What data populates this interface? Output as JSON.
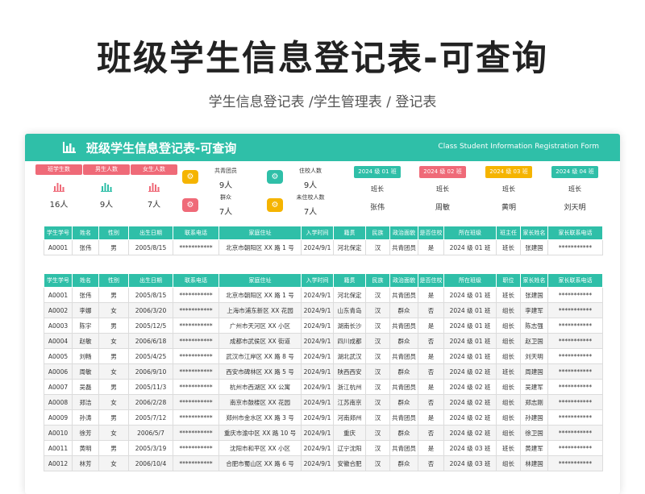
{
  "page": {
    "title": "班级学生信息登记表-可查询",
    "subtitle": "学生信息登记表 /学生管理表 / 登记表"
  },
  "banner": {
    "title": "班级学生信息登记表-可查询",
    "english": "Class Student Information Registration Form",
    "icon": "bar-chart-icon"
  },
  "stats": [
    {
      "label": "班学生数",
      "value": "16人"
    },
    {
      "label": "男生人数",
      "value": "9人"
    },
    {
      "label": "女生人数",
      "value": "7人"
    }
  ],
  "politics": [
    {
      "label": "共青团员",
      "value": "9人",
      "color": "#f5b400",
      "icon": "gear-icon"
    },
    {
      "label": "群众",
      "value": "7人",
      "color": "#ef6a78",
      "icon": "gear-icon"
    },
    {
      "label": "住校人数",
      "value": "9人",
      "color": "#2fbfa8",
      "icon": "gear-icon"
    },
    {
      "label": "未住校人数",
      "value": "7人",
      "color": "#f5b400",
      "icon": "gear-icon"
    }
  ],
  "groups": [
    {
      "label": "2024 级 01 班",
      "role": "班长",
      "name": "张伟",
      "color": "#2fbfa8"
    },
    {
      "label": "2024 级 02 班",
      "role": "班长",
      "name": "周敏",
      "color": "#ef6a78"
    },
    {
      "label": "2024 级 03 班",
      "role": "班长",
      "name": "黄明",
      "color": "#f5b400"
    },
    {
      "label": "2024 级 04 班",
      "role": "班长",
      "name": "刘天明",
      "color": "#2fbfa8"
    }
  ],
  "query": {
    "headers": [
      "学生学号",
      "姓名",
      "性别",
      "出生日期",
      "联系电话",
      "家庭住址",
      "入学时间",
      "籍贯",
      "民族",
      "政治面貌",
      "是否住校",
      "所在班级",
      "班主任",
      "家长姓名",
      "家长联系电话"
    ],
    "rows": [
      [
        "A0001",
        "张伟",
        "男",
        "2005/8/15",
        "***********",
        "北京市朝阳区 XX 路 1 号",
        "2024/9/1",
        "河北保定",
        "汉",
        "共青团员",
        "是",
        "2024 级 01 班",
        "班长",
        "张建国",
        "***********"
      ]
    ]
  },
  "main_table": {
    "headers": [
      "学生学号",
      "姓名",
      "性别",
      "出生日期",
      "联系电话",
      "家庭住址",
      "入学时间",
      "籍贯",
      "民族",
      "政治面貌",
      "是否住校",
      "所在班级",
      "职位",
      "家长姓名",
      "家长联系电话"
    ],
    "rows": [
      [
        "A0001",
        "张伟",
        "男",
        "2005/8/15",
        "***********",
        "北京市朝阳区 XX 路 1 号",
        "2024/9/1",
        "河北保定",
        "汉",
        "共青团员",
        "是",
        "2024 级 01 班",
        "班长",
        "张建国",
        "***********"
      ],
      [
        "A0002",
        "李娜",
        "女",
        "2006/3/20",
        "***********",
        "上海市浦东新区 XX 花园",
        "2024/9/1",
        "山东青岛",
        "汉",
        "群众",
        "否",
        "2024 级 01 班",
        "组长",
        "李建军",
        "***********"
      ],
      [
        "A0003",
        "陈宇",
        "男",
        "2005/12/5",
        "***********",
        "广州市天河区 XX 小区",
        "2024/9/1",
        "湖南长沙",
        "汉",
        "共青团员",
        "是",
        "2024 级 01 班",
        "组长",
        "陈志强",
        "***********"
      ],
      [
        "A0004",
        "赵敏",
        "女",
        "2006/6/18",
        "***********",
        "成都市武侯区 XX 街道",
        "2024/9/1",
        "四川成都",
        "汉",
        "群众",
        "否",
        "2024 级 01 班",
        "组长",
        "赵卫国",
        "***********"
      ],
      [
        "A0005",
        "刘畅",
        "男",
        "2005/4/25",
        "***********",
        "武汉市江岸区 XX 路 8 号",
        "2024/9/1",
        "湖北武汉",
        "汉",
        "共青团员",
        "是",
        "2024 级 01 班",
        "组长",
        "刘天明",
        "***********"
      ],
      [
        "A0006",
        "周敏",
        "女",
        "2006/9/10",
        "***********",
        "西安市碑林区 XX 路 5 号",
        "2024/9/1",
        "陕西西安",
        "汉",
        "群众",
        "否",
        "2024 级 02 班",
        "班长",
        "周建国",
        "***********"
      ],
      [
        "A0007",
        "吴磊",
        "男",
        "2005/11/3",
        "***********",
        "杭州市西湖区 XX 公寓",
        "2024/9/1",
        "浙江杭州",
        "汉",
        "共青团员",
        "是",
        "2024 级 02 班",
        "组长",
        "吴建军",
        "***********"
      ],
      [
        "A0008",
        "郑洁",
        "女",
        "2006/2/28",
        "***********",
        "南京市鼓楼区 XX 花园",
        "2024/9/1",
        "江苏南京",
        "汉",
        "群众",
        "否",
        "2024 级 02 班",
        "组长",
        "郑志刚",
        "***********"
      ],
      [
        "A0009",
        "孙涛",
        "男",
        "2005/7/12",
        "***********",
        "郑州市金水区 XX 路 3 号",
        "2024/9/1",
        "河南郑州",
        "汉",
        "共青团员",
        "是",
        "2024 级 02 班",
        "组长",
        "孙建国",
        "***********"
      ],
      [
        "A0010",
        "徐芳",
        "女",
        "2006/5/7",
        "***********",
        "重庆市渝中区 XX 路 10 号",
        "2024/9/1",
        "重庆",
        "汉",
        "群众",
        "否",
        "2024 级 02 班",
        "组长",
        "徐卫国",
        "***********"
      ],
      [
        "A0011",
        "黄明",
        "男",
        "2005/3/19",
        "***********",
        "沈阳市和平区 XX 小区",
        "2024/9/1",
        "辽宁沈阳",
        "汉",
        "共青团员",
        "是",
        "2024 级 03 班",
        "班长",
        "黄建军",
        "***********"
      ],
      [
        "A0012",
        "林芳",
        "女",
        "2006/10/4",
        "***********",
        "合肥市蜀山区 XX 路 6 号",
        "2024/9/1",
        "安徽合肥",
        "汉",
        "群众",
        "否",
        "2024 级 03 班",
        "组长",
        "林建国",
        "***********"
      ]
    ]
  }
}
